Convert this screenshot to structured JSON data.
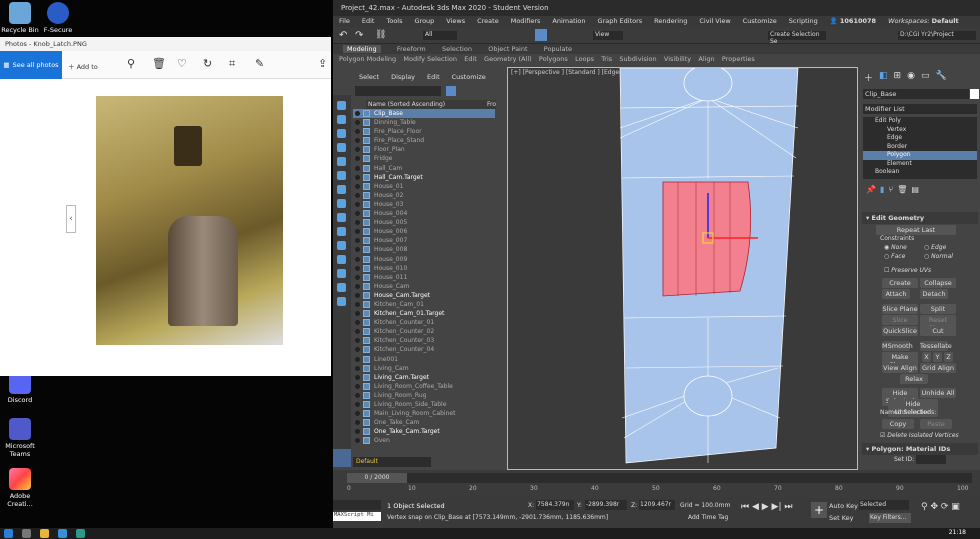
{
  "desktop": {
    "icons": [
      {
        "label": "Recycle Bin",
        "name": "recycle-bin-icon"
      },
      {
        "label": "F-Secure",
        "name": "f-secure-icon"
      },
      {
        "label": "Discord",
        "name": "discord-icon"
      },
      {
        "label": "Microsoft Teams",
        "name": "teams-icon"
      },
      {
        "label": "Adobe Creati...",
        "name": "adobe-cc-icon"
      }
    ]
  },
  "photos": {
    "title": "Photos - Knob_Latch.PNG",
    "see_all": "See all photos",
    "add_to": "Add to"
  },
  "max": {
    "title": "Project_42.max - Autodesk 3ds Max 2020 - Student Version",
    "menu": [
      "File",
      "Edit",
      "Tools",
      "Group",
      "Views",
      "Create",
      "Modifiers",
      "Animation",
      "Graph Editors",
      "Rendering",
      "Civil View",
      "Customize",
      "Scripting"
    ],
    "user_id": "10610078",
    "workspaces_label": "Workspaces:",
    "workspace": "Default",
    "filter_all": "All",
    "view": "View",
    "create_selection_set": "Create Selection Se",
    "project_path": "D:\\CGI Yr2\\Project",
    "ribbon_tabs": [
      "Modeling",
      "Freeform",
      "Selection",
      "Object Paint",
      "Populate"
    ],
    "ribbon_sub": [
      "Polygon Modeling",
      "Modify Selection",
      "Edit",
      "Geometry (All)",
      "Polygons",
      "Loops",
      "Tris",
      "Subdivision",
      "Visibility",
      "Align",
      "Properties"
    ],
    "explorer_menu": [
      "Select",
      "Display",
      "Edit",
      "Customize"
    ],
    "explorer_header": "Name (Sorted Ascending)",
    "explorer_header_right": "Fro",
    "scene_items": [
      "Clip_Base",
      "Dinning_Table",
      "Fire_Place_Floor",
      "Fire_Place_Stand",
      "Floor_Plan",
      "Fridge",
      "Hall_Cam",
      "Hall_Cam.Target",
      "House_01",
      "House_02",
      "House_03",
      "House_004",
      "House_005",
      "House_006",
      "House_007",
      "House_008",
      "House_009",
      "House_010",
      "House_011",
      "House_Cam",
      "House_Cam.Target",
      "Kitchen_Cam_01",
      "Kitchen_Cam_01.Target",
      "Kitchen_Counter_01",
      "Kitchen_Counter_02",
      "Kitchen_Counter_03",
      "Kitchen_Counter_04",
      "Line001",
      "Living_Cam",
      "Living_Cam.Target",
      "Living_Room_Coffee_Table",
      "Living_Room_Rug",
      "Living_Room_Side_Table",
      "Main_Living_Room_Cabinet",
      "One_Take_Cam",
      "One_Take_Cam.Target",
      "Oven"
    ],
    "layer": "Default",
    "viewport_label": "[+] [Perspective ] [Standard ] [Edged Faces ]",
    "object_name": "Clip_Base",
    "modifier_list": "Modifier List",
    "stack": [
      "Edit Poly",
      "Vertex",
      "Edge",
      "Border",
      "Polygon",
      "Element",
      "Boolean"
    ],
    "edit_geometry": {
      "title": "Edit Geometry",
      "repeat_last": "Repeat Last",
      "constraints": "Constraints",
      "none": "None",
      "edge": "Edge",
      "face": "Face",
      "normal": "Normal",
      "preserve_uvs": "Preserve UVs",
      "create": "Create",
      "collapse": "Collapse",
      "attach": "Attach",
      "detach": "Detach",
      "slice_plane": "Slice Plane",
      "split": "Split",
      "slice": "Slice",
      "reset_plane": "Reset Plane",
      "quickslice": "QuickSlice",
      "cut": "Cut",
      "msmooth": "MSmooth",
      "tessellate": "Tessellate",
      "make_planar": "Make Planar",
      "x": "X",
      "y": "Y",
      "z": "Z",
      "view_align": "View Align",
      "grid_align": "Grid Align",
      "relax": "Relax",
      "hide_selected": "Hide Selected",
      "unhide_all": "Unhide All",
      "hide_unselected": "Hide Unselected",
      "named_selections": "Named Selections:",
      "copy": "Copy",
      "paste": "Paste",
      "delete_isolated": "Delete Isolated Vertices"
    },
    "poly_material_ids": "Polygon: Material IDs",
    "set_id": "Set ID:",
    "time": "0 / 2000",
    "ticks": [
      "0",
      "10",
      "20",
      "30",
      "40",
      "50",
      "60",
      "70",
      "80",
      "90",
      "100"
    ],
    "status_selected": "1 Object Selected",
    "status_msg": "Vertex snap on Clip_Base at [7573.149mm, -2901.736mm, 1185.636mm]",
    "maxscript": "MAXScript Mi",
    "coord_x": "7584.379n",
    "coord_y": "-2899.398r",
    "coord_z": "1209.467r",
    "grid": "Grid = 100.0mm",
    "add_time_tag": "Add Time Tag",
    "auto_key": "Auto Key",
    "selected": "Selected",
    "set_key": "Set Key",
    "key_filters": "Key Filters..."
  },
  "taskbar": {
    "clock": "21:18"
  },
  "colors": {
    "selection_red": "#f2808f",
    "mesh_blue": "#a9c4ea",
    "accent_blue": "#1a73d9"
  }
}
